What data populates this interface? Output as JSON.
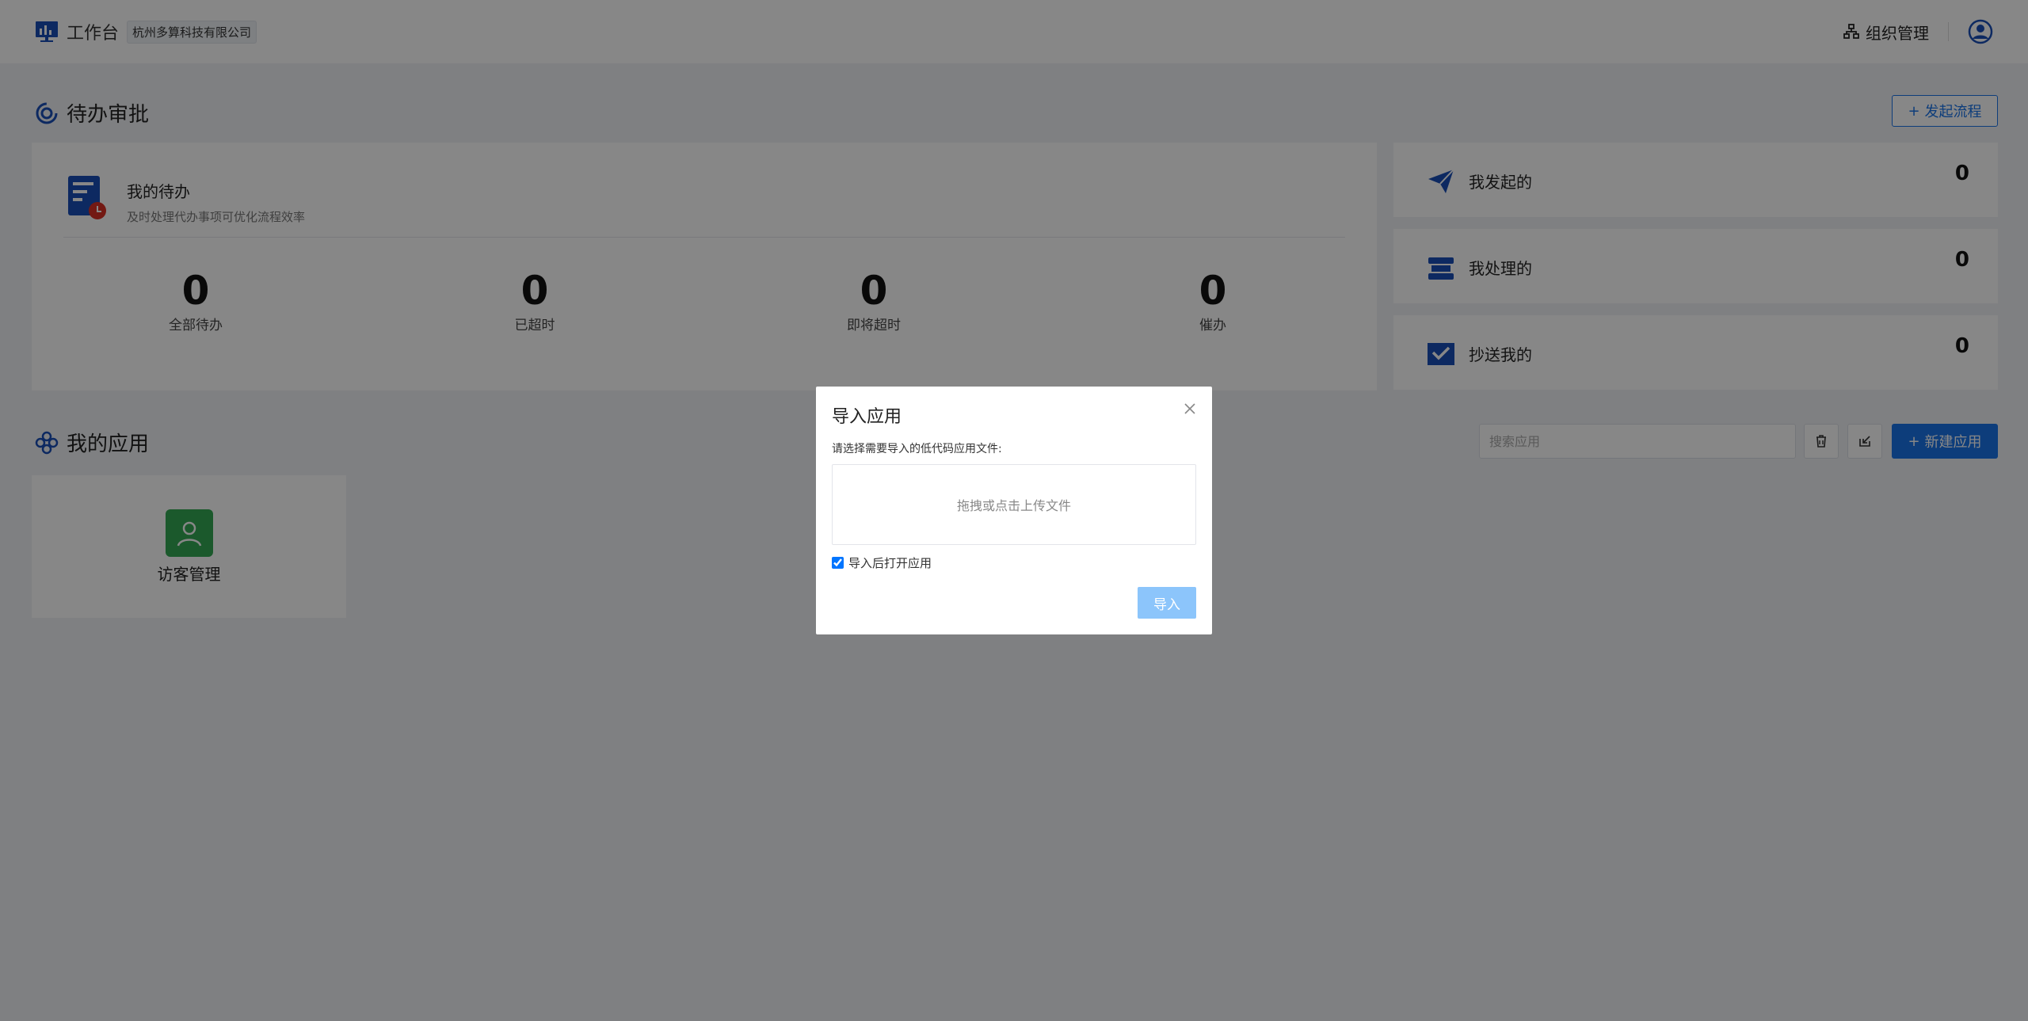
{
  "header": {
    "title": "工作台",
    "company": "杭州多算科技有限公司",
    "org_label": "组织管理"
  },
  "approval": {
    "section_title": "待办审批",
    "start_process_label": "发起流程",
    "my_todo_title": "我的待办",
    "my_todo_subtitle": "及时处理代办事项可优化流程效率",
    "stats": [
      {
        "value": "0",
        "label": "全部待办"
      },
      {
        "value": "0",
        "label": "已超时"
      },
      {
        "value": "0",
        "label": "即将超时"
      },
      {
        "value": "0",
        "label": "催办"
      }
    ],
    "side": [
      {
        "label": "我发起的",
        "value": "0"
      },
      {
        "label": "我处理的",
        "value": "0"
      },
      {
        "label": "抄送我的",
        "value": "0"
      }
    ]
  },
  "apps": {
    "section_title": "我的应用",
    "search_placeholder": "搜索应用",
    "new_app_label": "新建应用",
    "items": [
      {
        "name": "访客管理"
      }
    ]
  },
  "modal": {
    "title": "导入应用",
    "description": "请选择需要导入的低代码应用文件:",
    "upload_hint": "拖拽或点击上传文件",
    "checkbox_label": "导入后打开应用",
    "checkbox_checked": true,
    "import_label": "导入"
  },
  "colors": {
    "primary": "#1a73e8",
    "app_icon": "#34a853",
    "import_disabled": "#8cc5fb"
  }
}
